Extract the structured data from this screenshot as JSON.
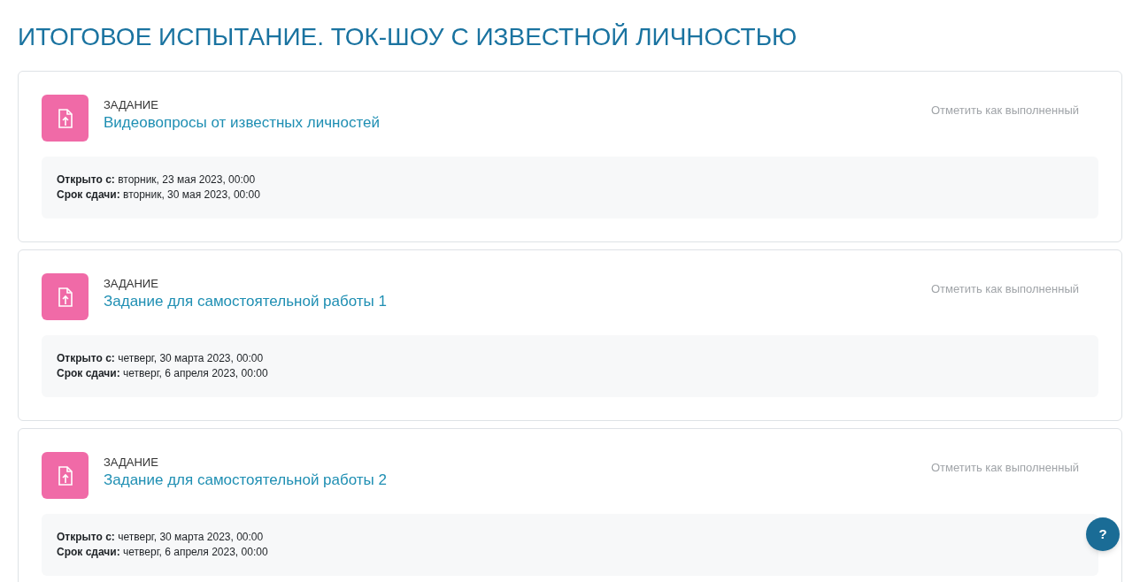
{
  "section_title": "ИТОГОВОЕ ИСПЫТАНИЕ. ТОК-ШОУ С ИЗВЕСТНОЙ ЛИЧНОСТЬЮ",
  "activities": [
    {
      "kind": "assign",
      "type_label": "ЗАДАНИЕ",
      "name": "Видеовопросы от известных личностей",
      "completion": "Отметить как выполненный",
      "dates": [
        {
          "label": "Открыто с:",
          "value": "вторник, 23 мая 2023, 00:00"
        },
        {
          "label": "Срок сдачи:",
          "value": "вторник, 30 мая 2023, 00:00"
        }
      ]
    },
    {
      "kind": "assign",
      "type_label": "ЗАДАНИЕ",
      "name": "Задание для самостоятельной работы 1",
      "completion": "Отметить как выполненный",
      "dates": [
        {
          "label": "Открыто с:",
          "value": "четверг, 30 марта 2023, 00:00"
        },
        {
          "label": "Срок сдачи:",
          "value": "четверг, 6 апреля 2023, 00:00"
        }
      ]
    },
    {
      "kind": "assign",
      "type_label": "ЗАДАНИЕ",
      "name": "Задание для самостоятельной работы 2",
      "completion": "Отметить как выполненный",
      "dates": [
        {
          "label": "Открыто с:",
          "value": "четверг, 30 марта 2023, 00:00"
        },
        {
          "label": "Срок сдачи:",
          "value": "четверг, 6 апреля 2023, 00:00"
        }
      ]
    }
  ],
  "help_button": "?"
}
